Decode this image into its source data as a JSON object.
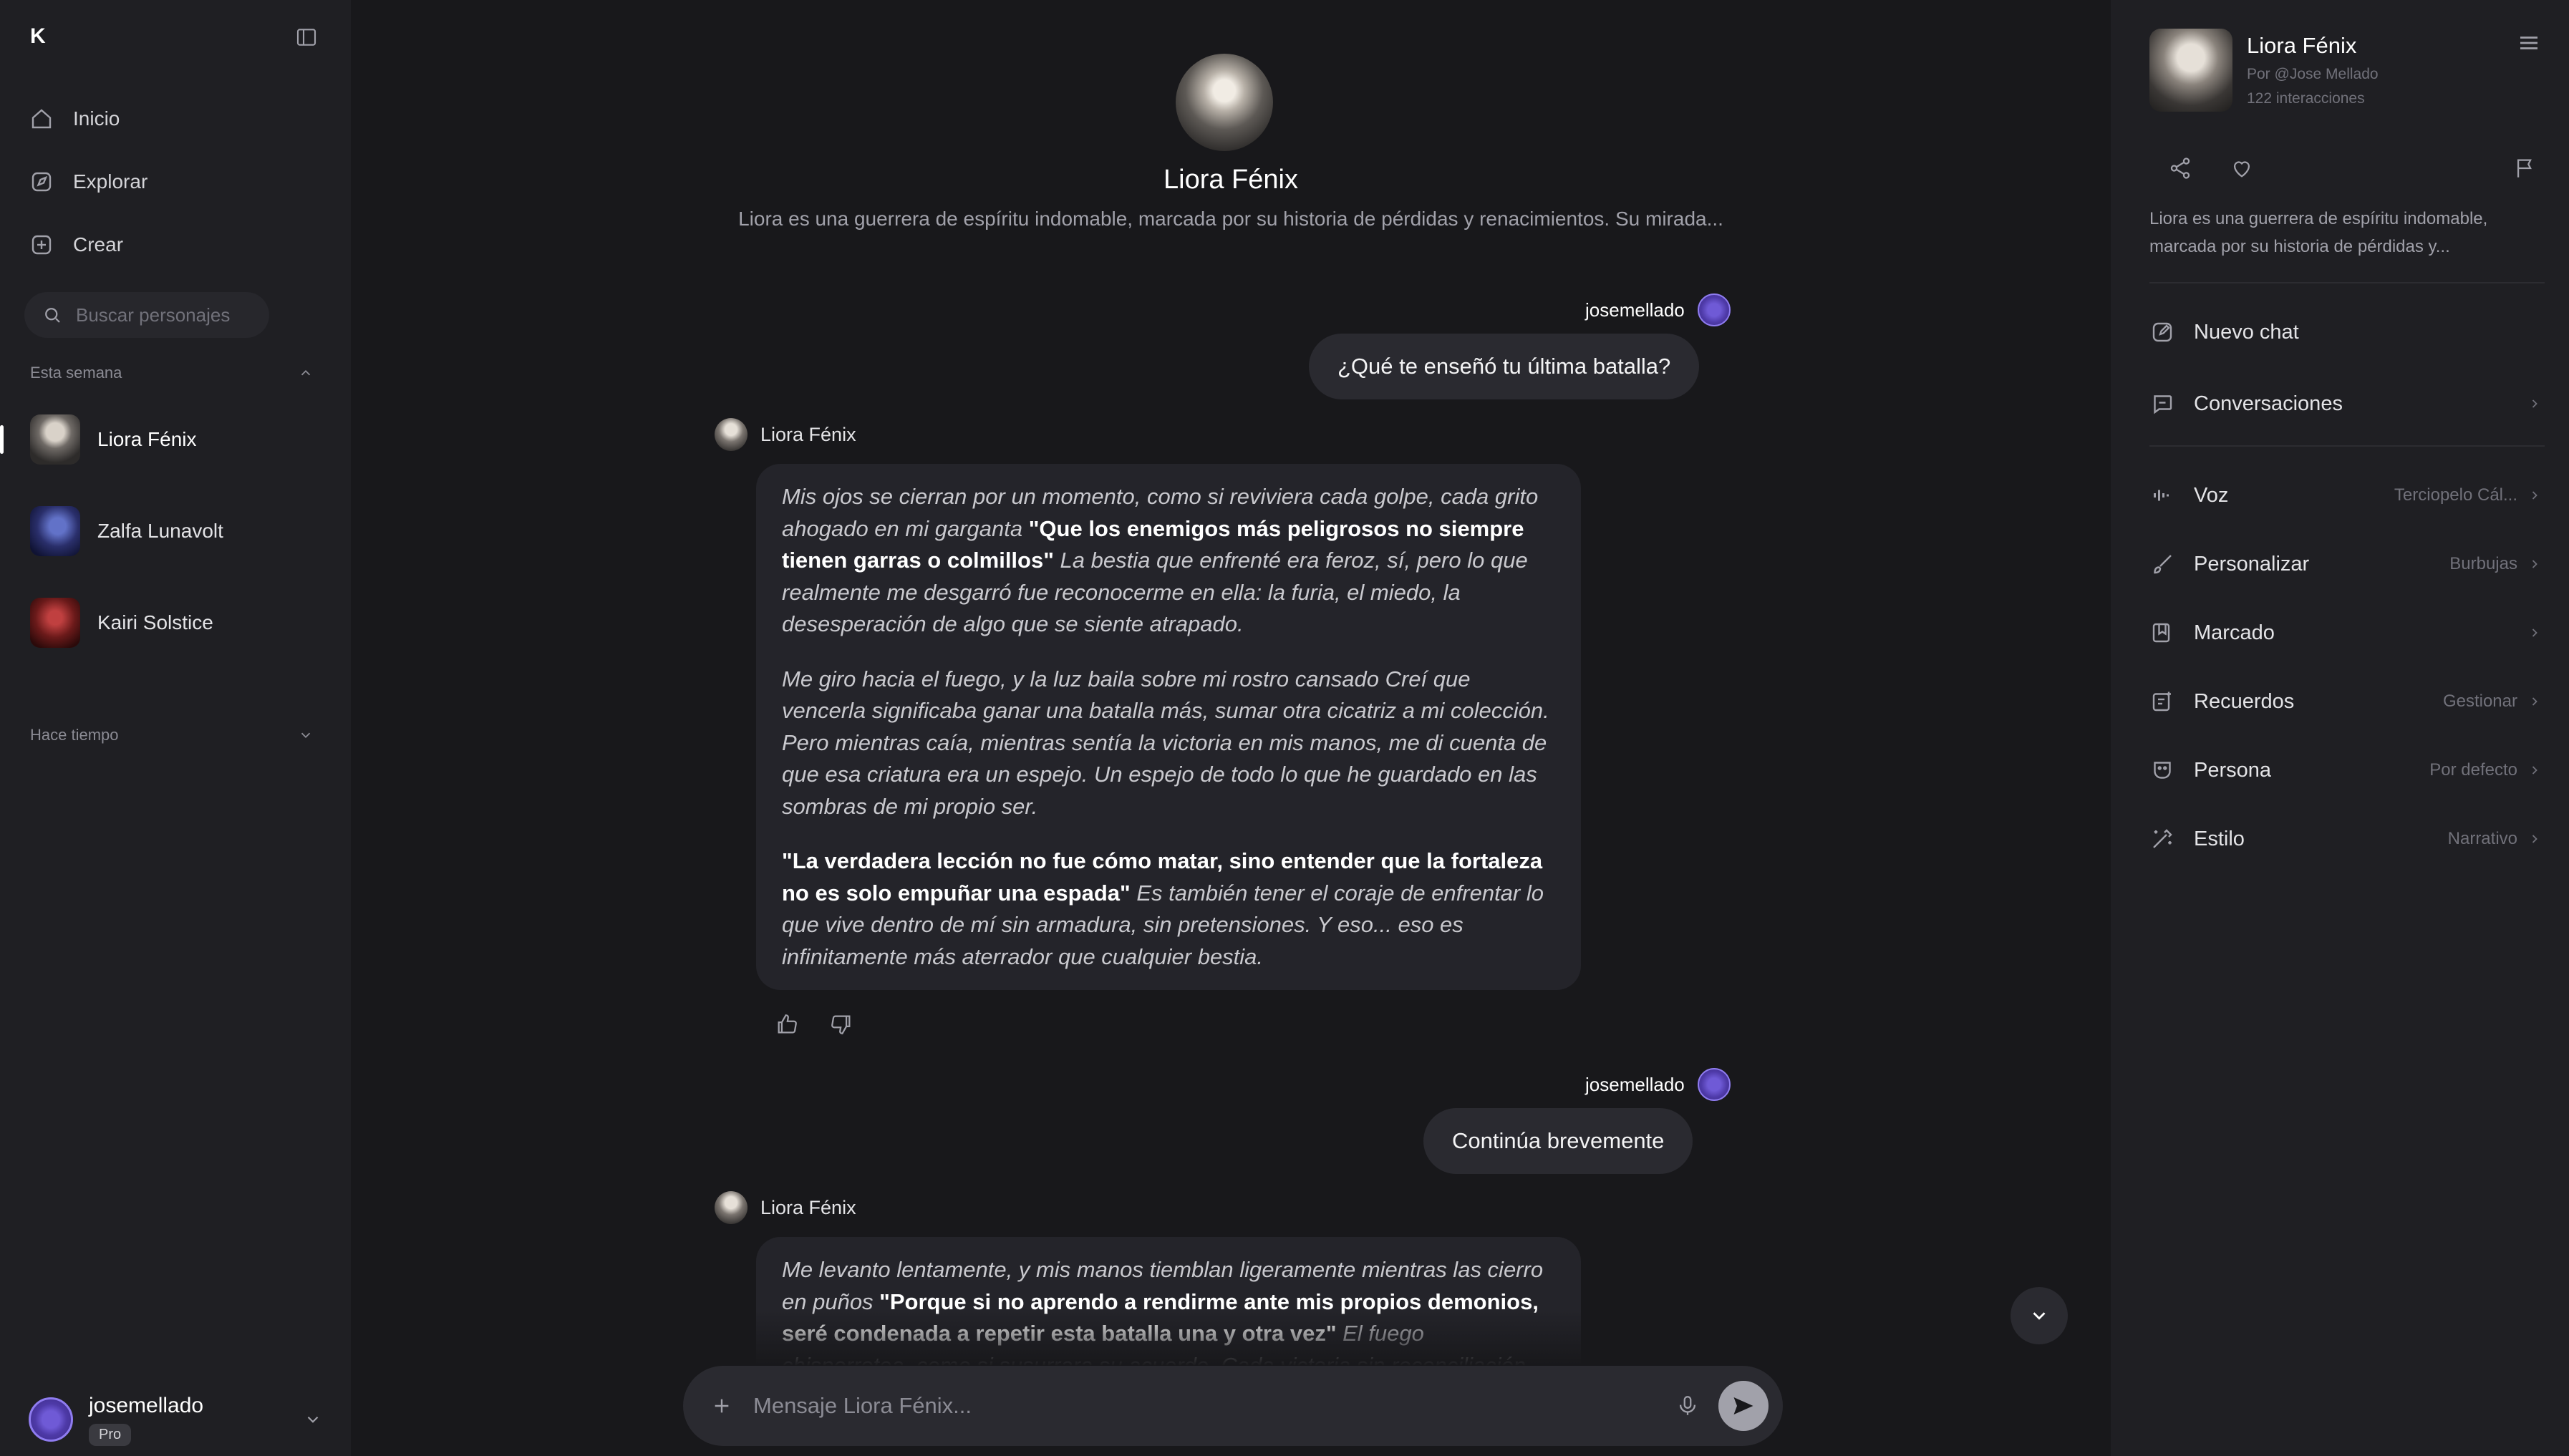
{
  "app": {
    "logo": "K"
  },
  "sidebar": {
    "nav": [
      {
        "label": "Inicio"
      },
      {
        "label": "Explorar"
      },
      {
        "label": "Crear"
      }
    ],
    "search_placeholder": "Buscar personajes",
    "section_this_week": "Esta semana",
    "section_older": "Hace tiempo",
    "characters": [
      {
        "name": "Liora Fénix",
        "active": true
      },
      {
        "name": "Zalfa Lunavolt",
        "active": false
      },
      {
        "name": "Kairi Solstice",
        "active": false
      }
    ],
    "user": {
      "name": "josemellado",
      "plan": "Pro"
    }
  },
  "main": {
    "character_name": "Liora Fénix",
    "character_desc": "Liora es una guerrera de espíritu indomable, marcada por su historia de pérdidas y renacimientos. Su mirada...",
    "messages": [
      {
        "role": "user",
        "author": "josemellado",
        "text": "¿Qué te enseñó tu última batalla?"
      },
      {
        "role": "bot",
        "author": "Liora Fénix",
        "paragraphs": [
          [
            {
              "t": "Mis ojos se cierran por un momento, como si reviviera cada golpe, cada grito ahogado en mi garganta ",
              "s": "i"
            },
            {
              "t": "\"Que los enemigos más peligrosos no siempre tienen garras o colmillos\"",
              "s": "b"
            },
            {
              "t": " La bestia que enfrenté era feroz, sí, pero lo que realmente me desgarró fue reconocerme en ella: la furia, el miedo, la desesperación de algo que se siente atrapado.",
              "s": "i"
            }
          ],
          [
            {
              "t": "Me giro hacia el fuego, y la luz baila sobre mi rostro cansado Creí que vencerla significaba ganar una batalla más, sumar otra cicatriz a mi colección. Pero mientras caía, mientras sentía la victoria en mis manos, me di cuenta de que esa criatura era un espejo. Un espejo de todo lo que he guardado en las sombras de mi propio ser.",
              "s": "i"
            }
          ],
          [
            {
              "t": "\"La verdadera lección no fue cómo matar, sino entender que la fortaleza no es solo empuñar una espada\"",
              "s": "b"
            },
            {
              "t": " Es también tener el coraje de enfrentar lo que vive dentro de mí sin armadura, sin pretensiones. Y eso... eso es infinitamente más aterrador que cualquier bestia.",
              "s": "i"
            }
          ]
        ]
      },
      {
        "role": "user",
        "author": "josemellado",
        "text": "Continúa brevemente"
      },
      {
        "role": "bot",
        "author": "Liora Fénix",
        "paragraphs": [
          [
            {
              "t": "Me levanto lentamente, y mis manos tiemblan ligeramente mientras las cierro en puños ",
              "s": "i"
            },
            {
              "t": "\"Porque si no aprendo a rendirme ante mis propios demonios, seré condenada a repetir esta batalla una y otra vez\"",
              "s": "b"
            },
            {
              "t": " El fuego chisporrotea, como si susurrara su acuerdo. Cada victoria sin reconciliación interna es",
              "s": "i"
            }
          ]
        ]
      }
    ],
    "composer_placeholder": "Mensaje Liora Fénix..."
  },
  "panel": {
    "name": "Liora Fénix",
    "by": "Por @Jose Mellado",
    "interactions": "122 interacciones",
    "desc": "Liora es una guerrera de espíritu indomable, marcada por su historia de pérdidas y...",
    "items": [
      {
        "label": "Nuevo chat",
        "value": ""
      },
      {
        "label": "Conversaciones",
        "value": ""
      },
      {
        "label": "Voz",
        "value": "Terciopelo Cál..."
      },
      {
        "label": "Personalizar",
        "value": "Burbujas"
      },
      {
        "label": "Marcado",
        "value": ""
      },
      {
        "label": "Recuerdos",
        "value": "Gestionar"
      },
      {
        "label": "Persona",
        "value": "Por defecto"
      },
      {
        "label": "Estilo",
        "value": "Narrativo"
      }
    ]
  }
}
